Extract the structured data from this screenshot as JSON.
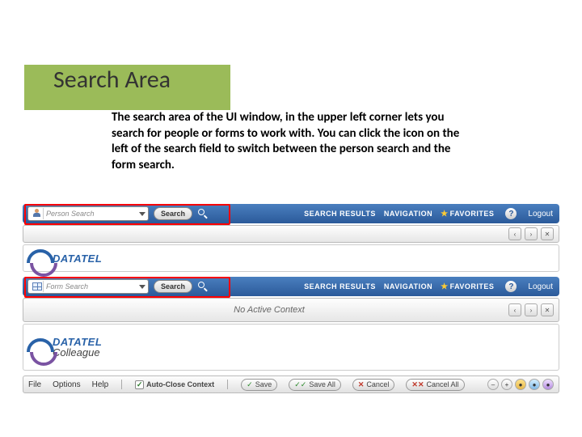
{
  "heading": "Search Area",
  "description": "The search area of the UI window, in the upper left corner lets you search for people or forms to work with. You can click the icon on the left of the search field to switch between the person search and the form search.",
  "row1": {
    "search_placeholder": "Person Search",
    "search_button": "Search",
    "nav": {
      "results": "SEARCH RESULTS",
      "navigation": "NAVIGATION",
      "favorites": "FAVORITES"
    },
    "help": "?",
    "logout": "Logout"
  },
  "row2": {
    "search_placeholder": "Form Search",
    "search_button": "Search",
    "nav": {
      "results": "SEARCH RESULTS",
      "navigation": "NAVIGATION",
      "favorites": "FAVORITES"
    },
    "help": "?",
    "logout": "Logout"
  },
  "logo": {
    "line1": "DATATEL",
    "line2": "Colleague"
  },
  "context": {
    "no_active": "No Active Context"
  },
  "menubar": {
    "file": "File",
    "options": "Options",
    "help": "Help",
    "auto_close": "Auto-Close Context",
    "save": "Save",
    "save_all": "Save All",
    "cancel": "Cancel",
    "cancel_all": "Cancel All"
  }
}
